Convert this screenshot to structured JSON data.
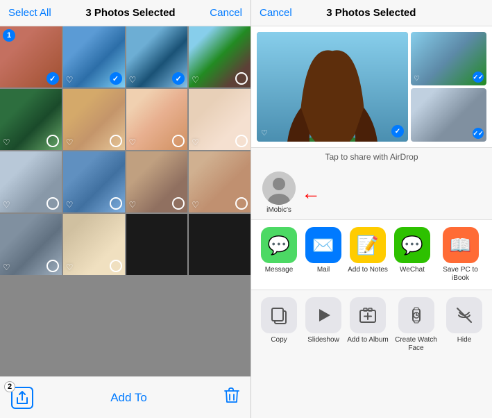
{
  "left_panel": {
    "header": {
      "select_all": "Select All",
      "count": "3 Photos Selected",
      "cancel": "Cancel"
    },
    "photos": [
      {
        "id": 1,
        "selected": true,
        "badge": "1",
        "color": "p1"
      },
      {
        "id": 2,
        "selected": true,
        "color": "p2"
      },
      {
        "id": 3,
        "selected": true,
        "color": "p3"
      },
      {
        "id": 4,
        "selected": false,
        "color": "p4"
      },
      {
        "id": 5,
        "selected": false,
        "color": "p5"
      },
      {
        "id": 6,
        "selected": false,
        "color": "p6"
      },
      {
        "id": 7,
        "selected": false,
        "color": "p7"
      },
      {
        "id": 8,
        "selected": false,
        "color": "p8"
      },
      {
        "id": 9,
        "selected": false,
        "color": "p9"
      },
      {
        "id": 10,
        "selected": false,
        "color": "p10"
      },
      {
        "id": 11,
        "selected": false,
        "color": "p11"
      },
      {
        "id": 12,
        "selected": false,
        "color": "p12"
      },
      {
        "id": 13,
        "selected": false,
        "color": "p13"
      },
      {
        "id": 14,
        "selected": false,
        "color": "p14"
      }
    ],
    "footer": {
      "badge": "2",
      "add_to": "Add To"
    }
  },
  "right_panel": {
    "header": {
      "cancel": "Cancel",
      "count": "3 Photos Selected"
    },
    "airdrop_hint": "Tap to share with AirDrop",
    "contact_name": "iMobic's",
    "share_actions": [
      {
        "id": "message",
        "label": "Message",
        "color": "icon-message",
        "icon": "💬"
      },
      {
        "id": "mail",
        "label": "Mail",
        "color": "icon-mail",
        "icon": "✉️"
      },
      {
        "id": "notes",
        "label": "Add to Notes",
        "color": "icon-notes",
        "icon": "📝"
      },
      {
        "id": "wechat",
        "label": "WeChat",
        "color": "icon-wechat",
        "icon": "💬"
      },
      {
        "id": "book",
        "label": "Save PC to iBook",
        "color": "icon-book",
        "icon": "📖"
      }
    ],
    "action_buttons": [
      {
        "id": "copy",
        "label": "Copy",
        "icon": "⎘"
      },
      {
        "id": "slideshow",
        "label": "Slideshow",
        "icon": "▶"
      },
      {
        "id": "add-album",
        "label": "Add to Album",
        "icon": "➕"
      },
      {
        "id": "watch-face",
        "label": "Create Watch Face",
        "icon": "⌚"
      },
      {
        "id": "hide",
        "label": "Hide",
        "icon": "⊘"
      }
    ]
  }
}
